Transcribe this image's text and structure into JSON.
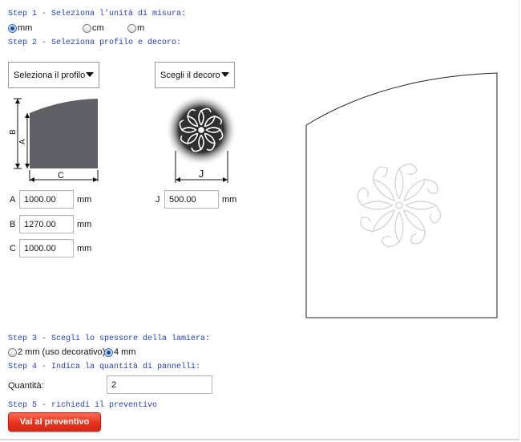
{
  "step1": {
    "title": "Step 1 - Seleziona l'unità di misura:",
    "units": [
      {
        "label": "mm",
        "selected": true
      },
      {
        "label": "cm",
        "selected": false
      },
      {
        "label": "m",
        "selected": false
      }
    ]
  },
  "step2": {
    "title": "Step 2 - Seleziona profilo e decoro:",
    "profile_select": "Seleziona il profilo",
    "decor_select": "Scegli il decoro",
    "profile_diagram": {
      "label_b": "B",
      "label_a": "A",
      "label_c": "C"
    },
    "decor_diagram": {
      "label_j": "J"
    },
    "fields": {
      "A": {
        "label": "A",
        "value": "1000.00",
        "unit": "mm"
      },
      "B": {
        "label": "B",
        "value": "1270.00",
        "unit": "mm"
      },
      "C": {
        "label": "C",
        "value": "1000.00",
        "unit": "mm"
      },
      "J": {
        "label": "J",
        "value": "500.00",
        "unit": "mm"
      }
    }
  },
  "step3": {
    "title": "Step 3 - Scegli lo spessore della lamiera:",
    "options": [
      {
        "label": "2 mm (uso decorativo)",
        "selected": false
      },
      {
        "label": "4 mm",
        "selected": true
      }
    ]
  },
  "step4": {
    "title": "Step 4 - Indica la quantità di pannelli:",
    "quantity_label": "Quantità:",
    "quantity_value": "2"
  },
  "step5": {
    "title": "Step 5 - richiedi il preventivo",
    "button": "Vai al preventivo"
  },
  "colors": {
    "step_text": "#1f3fbf",
    "button": "#e8321e",
    "profile_fill": "#5f6066"
  }
}
